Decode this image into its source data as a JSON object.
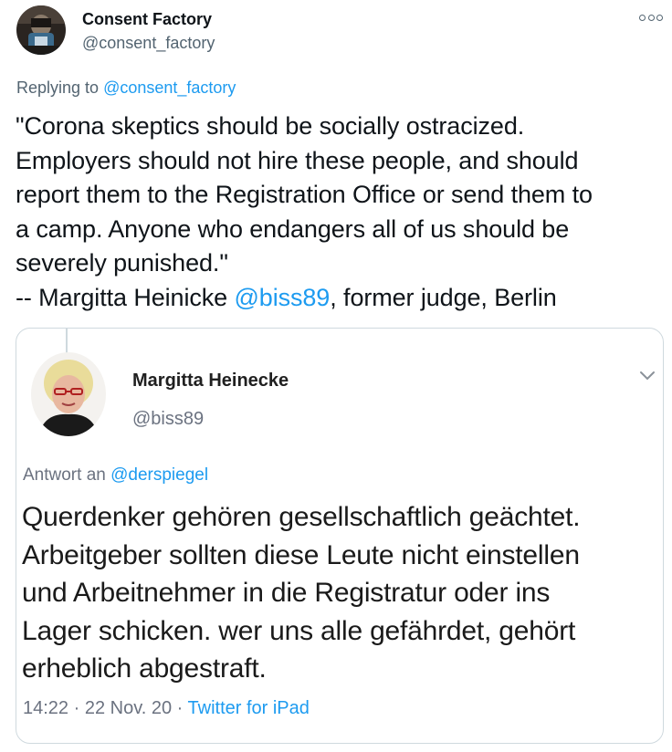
{
  "tweet": {
    "author": {
      "name": "Consent Factory",
      "handle": "@consent_factory",
      "avatar_icon": "masked-figure-avatar"
    },
    "more_icon": "more-options-icon",
    "replying_to": {
      "prefix": "Replying to",
      "handle": "@consent_factory"
    },
    "text_lines": [
      "\"Corona skeptics should be socially ostracized.",
      "Employers should not hire these people, and should",
      "report them to the Registration Office or send them to",
      "a camp. Anyone who endangers all of us should be",
      "severely punished.\""
    ],
    "attribution": {
      "prefix": "-- Margitta Heinicke",
      "mention": "@biss89",
      "suffix": ", former judge, Berlin"
    }
  },
  "embedded": {
    "author": {
      "name": "Margitta Heinecke",
      "handle": "@biss89",
      "avatar_icon": "portrait-avatar"
    },
    "chevron_icon": "chevron-down-icon",
    "reply": {
      "prefix": "Antwort an",
      "handle": "@derspiegel"
    },
    "text_lines": [
      "Querdenker gehören gesellschaftlich geächtet.",
      "Arbeitgeber sollten diese Leute nicht einstellen",
      "und Arbeitnehmer in die Registratur oder ins",
      "Lager schicken. wer uns alle gefährdet, gehört",
      "erheblich abgestraft."
    ],
    "meta": {
      "time": "14:22",
      "separator": " · ",
      "date": "22 Nov. 20",
      "source": "Twitter for iPad"
    }
  },
  "colors": {
    "link": "#1d9bf0",
    "secondary_text": "#536471",
    "primary_text": "#0f1419",
    "border": "#cfd9de"
  }
}
